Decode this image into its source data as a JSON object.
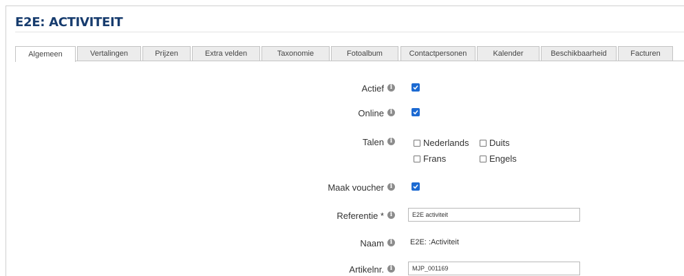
{
  "header": {
    "title": "E2E: ACTIVITEIT"
  },
  "tabs": [
    {
      "label": "Algemeen"
    },
    {
      "label": "Vertalingen"
    },
    {
      "label": "Prijzen"
    },
    {
      "label": "Extra velden"
    },
    {
      "label": "Taxonomie"
    },
    {
      "label": "Fotoalbum"
    },
    {
      "label": "Contactpersonen"
    },
    {
      "label": "Kalender"
    },
    {
      "label": "Beschikbaarheid"
    },
    {
      "label": "Facturen"
    }
  ],
  "form": {
    "actief": {
      "label": "Actief",
      "checked": true
    },
    "online": {
      "label": "Online",
      "checked": true
    },
    "talen": {
      "label": "Talen",
      "options": [
        {
          "label": "Nederlands",
          "checked": false
        },
        {
          "label": "Duits",
          "checked": false
        },
        {
          "label": "Frans",
          "checked": false
        },
        {
          "label": "Engels",
          "checked": false
        }
      ]
    },
    "maak_voucher": {
      "label": "Maak voucher",
      "checked": true
    },
    "referentie": {
      "label": "Referentie *",
      "value": "E2E activiteit"
    },
    "naam": {
      "label": "Naam",
      "value": "E2E: :Activiteit"
    },
    "artikelnr": {
      "label": "Artikelnr.",
      "value": "MJP_001169"
    }
  }
}
